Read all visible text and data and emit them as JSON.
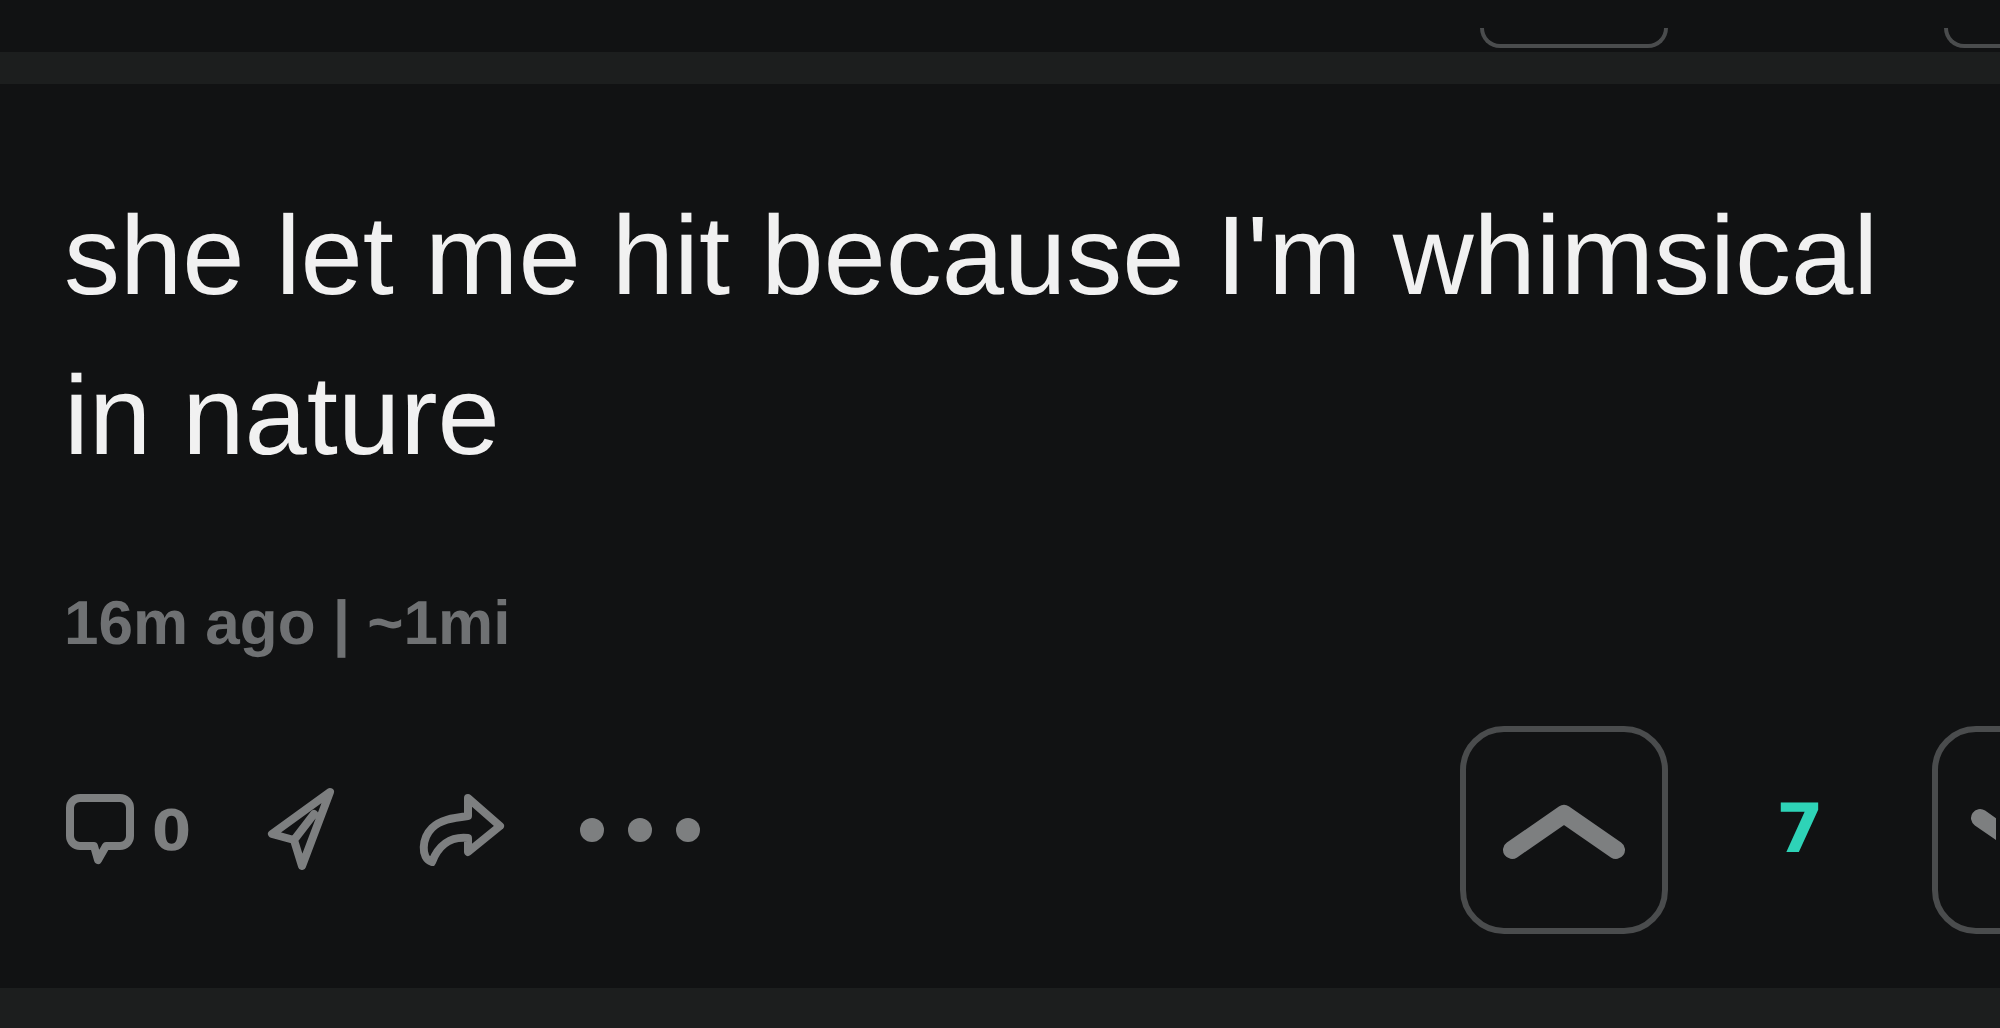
{
  "post": {
    "text": "she let me hit because I'm whimsical in nature",
    "meta": "16m ago | ~1mi",
    "comment_count": "0",
    "score": "7",
    "upvoted": false,
    "downvoted": false
  }
}
